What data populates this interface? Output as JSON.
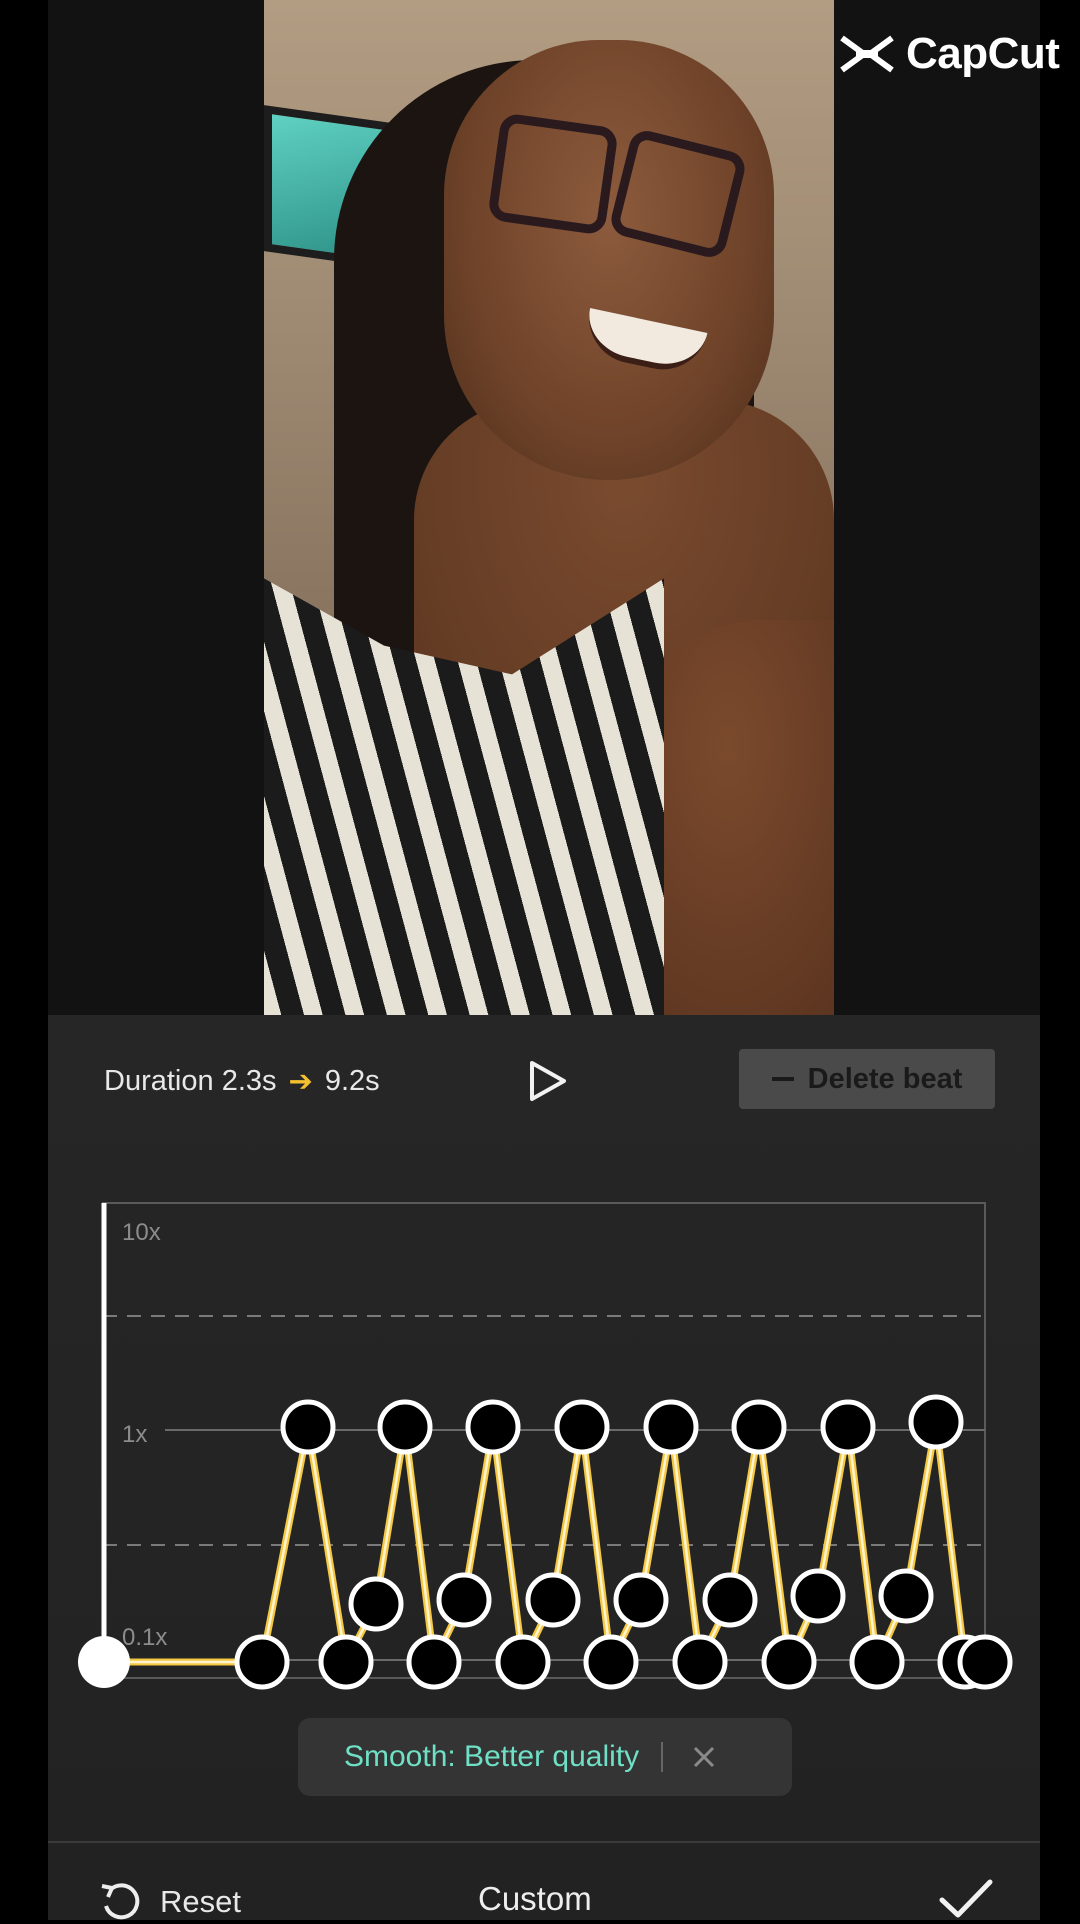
{
  "brand": {
    "name": "CapCut"
  },
  "editor": {
    "duration_label": "Duration",
    "duration_from": "2.3s",
    "duration_arrow": "➔",
    "duration_to": "9.2s",
    "delete_beat_label": "Delete beat",
    "graph_labels": {
      "top": "10x",
      "mid": "1x",
      "low": "0.1x"
    },
    "playhead_speed": "0.1x",
    "beat_count": 26,
    "smooth_label": "Smooth: Better quality",
    "mode_label": "Custom",
    "reset_label": "Reset"
  },
  "colors": {
    "accent_curve": "#f5c842",
    "smooth_text": "#6fe0c6",
    "panel_bg": "#242424"
  },
  "icons": {
    "play": "play-icon",
    "reset": "reset-icon",
    "confirm": "check-icon",
    "close": "close-icon",
    "brand": "capcut-logo-icon"
  }
}
